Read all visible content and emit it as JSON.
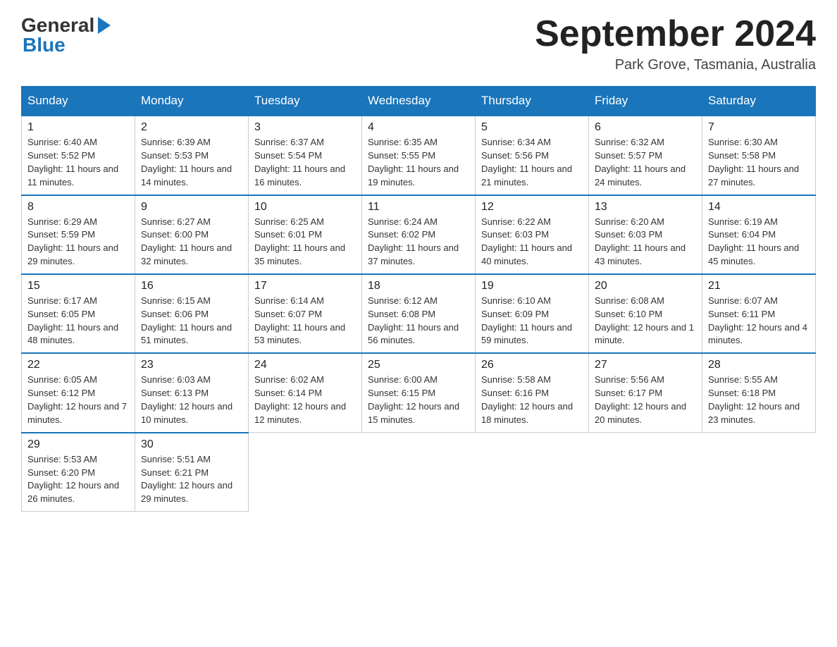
{
  "header": {
    "logo_general": "General",
    "logo_blue": "Blue",
    "title": "September 2024",
    "subtitle": "Park Grove, Tasmania, Australia"
  },
  "days": [
    "Sunday",
    "Monday",
    "Tuesday",
    "Wednesday",
    "Thursday",
    "Friday",
    "Saturday"
  ],
  "weeks": [
    [
      {
        "num": "1",
        "sunrise": "6:40 AM",
        "sunset": "5:52 PM",
        "daylight": "11 hours and 11 minutes."
      },
      {
        "num": "2",
        "sunrise": "6:39 AM",
        "sunset": "5:53 PM",
        "daylight": "11 hours and 14 minutes."
      },
      {
        "num": "3",
        "sunrise": "6:37 AM",
        "sunset": "5:54 PM",
        "daylight": "11 hours and 16 minutes."
      },
      {
        "num": "4",
        "sunrise": "6:35 AM",
        "sunset": "5:55 PM",
        "daylight": "11 hours and 19 minutes."
      },
      {
        "num": "5",
        "sunrise": "6:34 AM",
        "sunset": "5:56 PM",
        "daylight": "11 hours and 21 minutes."
      },
      {
        "num": "6",
        "sunrise": "6:32 AM",
        "sunset": "5:57 PM",
        "daylight": "11 hours and 24 minutes."
      },
      {
        "num": "7",
        "sunrise": "6:30 AM",
        "sunset": "5:58 PM",
        "daylight": "11 hours and 27 minutes."
      }
    ],
    [
      {
        "num": "8",
        "sunrise": "6:29 AM",
        "sunset": "5:59 PM",
        "daylight": "11 hours and 29 minutes."
      },
      {
        "num": "9",
        "sunrise": "6:27 AM",
        "sunset": "6:00 PM",
        "daylight": "11 hours and 32 minutes."
      },
      {
        "num": "10",
        "sunrise": "6:25 AM",
        "sunset": "6:01 PM",
        "daylight": "11 hours and 35 minutes."
      },
      {
        "num": "11",
        "sunrise": "6:24 AM",
        "sunset": "6:02 PM",
        "daylight": "11 hours and 37 minutes."
      },
      {
        "num": "12",
        "sunrise": "6:22 AM",
        "sunset": "6:03 PM",
        "daylight": "11 hours and 40 minutes."
      },
      {
        "num": "13",
        "sunrise": "6:20 AM",
        "sunset": "6:03 PM",
        "daylight": "11 hours and 43 minutes."
      },
      {
        "num": "14",
        "sunrise": "6:19 AM",
        "sunset": "6:04 PM",
        "daylight": "11 hours and 45 minutes."
      }
    ],
    [
      {
        "num": "15",
        "sunrise": "6:17 AM",
        "sunset": "6:05 PM",
        "daylight": "11 hours and 48 minutes."
      },
      {
        "num": "16",
        "sunrise": "6:15 AM",
        "sunset": "6:06 PM",
        "daylight": "11 hours and 51 minutes."
      },
      {
        "num": "17",
        "sunrise": "6:14 AM",
        "sunset": "6:07 PM",
        "daylight": "11 hours and 53 minutes."
      },
      {
        "num": "18",
        "sunrise": "6:12 AM",
        "sunset": "6:08 PM",
        "daylight": "11 hours and 56 minutes."
      },
      {
        "num": "19",
        "sunrise": "6:10 AM",
        "sunset": "6:09 PM",
        "daylight": "11 hours and 59 minutes."
      },
      {
        "num": "20",
        "sunrise": "6:08 AM",
        "sunset": "6:10 PM",
        "daylight": "12 hours and 1 minute."
      },
      {
        "num": "21",
        "sunrise": "6:07 AM",
        "sunset": "6:11 PM",
        "daylight": "12 hours and 4 minutes."
      }
    ],
    [
      {
        "num": "22",
        "sunrise": "6:05 AM",
        "sunset": "6:12 PM",
        "daylight": "12 hours and 7 minutes."
      },
      {
        "num": "23",
        "sunrise": "6:03 AM",
        "sunset": "6:13 PM",
        "daylight": "12 hours and 10 minutes."
      },
      {
        "num": "24",
        "sunrise": "6:02 AM",
        "sunset": "6:14 PM",
        "daylight": "12 hours and 12 minutes."
      },
      {
        "num": "25",
        "sunrise": "6:00 AM",
        "sunset": "6:15 PM",
        "daylight": "12 hours and 15 minutes."
      },
      {
        "num": "26",
        "sunrise": "5:58 AM",
        "sunset": "6:16 PM",
        "daylight": "12 hours and 18 minutes."
      },
      {
        "num": "27",
        "sunrise": "5:56 AM",
        "sunset": "6:17 PM",
        "daylight": "12 hours and 20 minutes."
      },
      {
        "num": "28",
        "sunrise": "5:55 AM",
        "sunset": "6:18 PM",
        "daylight": "12 hours and 23 minutes."
      }
    ],
    [
      {
        "num": "29",
        "sunrise": "5:53 AM",
        "sunset": "6:20 PM",
        "daylight": "12 hours and 26 minutes."
      },
      {
        "num": "30",
        "sunrise": "5:51 AM",
        "sunset": "6:21 PM",
        "daylight": "12 hours and 29 minutes."
      },
      null,
      null,
      null,
      null,
      null
    ]
  ]
}
